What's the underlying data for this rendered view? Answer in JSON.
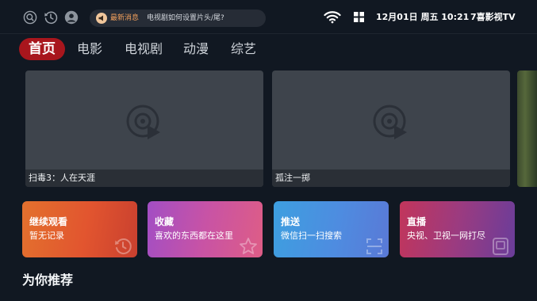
{
  "topbar": {
    "icons": [
      "search-icon",
      "history-icon",
      "user-icon"
    ],
    "notice": {
      "tag": "最新消息",
      "message": "电视剧如何设置片头/尾?"
    },
    "datetime": "12月01日 周五 10:21",
    "brand": "7喜影视TV"
  },
  "tabs": [
    {
      "label": "首页",
      "active": true
    },
    {
      "label": "电影",
      "active": false
    },
    {
      "label": "电视剧",
      "active": false
    },
    {
      "label": "动漫",
      "active": false
    },
    {
      "label": "综艺",
      "active": false
    }
  ],
  "banners": [
    {
      "title": "扫毒3：人在天涯",
      "icon": "video-placeholder-icon"
    },
    {
      "title": "孤注一掷",
      "icon": "video-placeholder-icon"
    }
  ],
  "functions": [
    {
      "title": "继续观看",
      "subtitle": "暂无记录",
      "icon": "history-icon",
      "color": "#e2552f"
    },
    {
      "title": "收藏",
      "subtitle": "喜欢的东西都在这里",
      "icon": "star-icon",
      "color": "#c853a5"
    },
    {
      "title": "推送",
      "subtitle": "微信扫一扫搜索",
      "icon": "scan-icon",
      "color": "#4e8ce0"
    },
    {
      "title": "直播",
      "subtitle": "央视、卫视一网打尽",
      "icon": "tv-icon",
      "color": "#9b3b80"
    }
  ],
  "section": {
    "title": "为你推荐"
  },
  "colors": {
    "background": "#111822",
    "accent": "#a8161d",
    "notice_tag": "#f2a05c"
  }
}
